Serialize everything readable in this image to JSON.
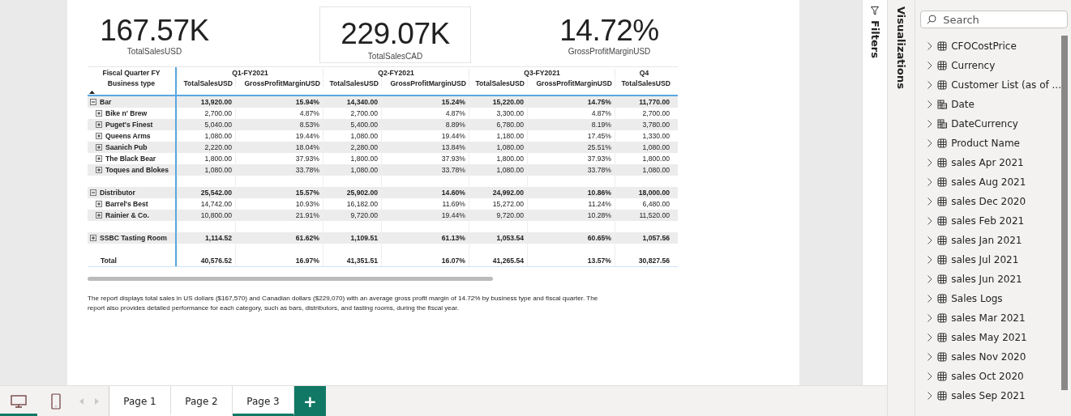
{
  "kpis": [
    {
      "value": "167.57K",
      "label": "TotalSalesUSD",
      "selected": false
    },
    {
      "value": "229.07K",
      "label": "TotalSalesCAD",
      "selected": true
    },
    {
      "value": "14.72%",
      "label": "GrossProfitMarginUSD",
      "selected": false
    }
  ],
  "matrix": {
    "corner_top": "Fiscal Quarter FY",
    "corner_bottom": "Business type",
    "column_groups": [
      {
        "label": "Q1-FY2021",
        "columns": [
          "TotalSalesUSD",
          "GrossProfitMarginUSD"
        ]
      },
      {
        "label": "Q2-FY2021",
        "columns": [
          "TotalSalesUSD",
          "GrossProfitMarginUSD"
        ]
      },
      {
        "label": "Q3-FY2021",
        "columns": [
          "TotalSalesUSD",
          "GrossProfitMarginUSD"
        ]
      },
      {
        "label": "Q4",
        "columns": [
          "TotalSalesUSD"
        ]
      }
    ],
    "rows": [
      {
        "kind": "group",
        "label": "Bar",
        "expanded": true,
        "cells": [
          "13,920.00",
          "15.94%",
          "14,340.00",
          "15.24%",
          "15,220.00",
          "14.75%",
          "11,770.00"
        ]
      },
      {
        "kind": "item",
        "label": "Bike n' Brew",
        "expanded": false,
        "cells": [
          "2,700.00",
          "4.87%",
          "2,700.00",
          "4.87%",
          "3,300.00",
          "4.87%",
          "2,700.00"
        ]
      },
      {
        "kind": "item",
        "label": "Puget's Finest",
        "expanded": false,
        "cells": [
          "5,040.00",
          "8.53%",
          "5,400.00",
          "8.89%",
          "6,780.00",
          "8.19%",
          "3,780.00"
        ]
      },
      {
        "kind": "item",
        "label": "Queens Arms",
        "expanded": false,
        "cells": [
          "1,080.00",
          "19.44%",
          "1,080.00",
          "19.44%",
          "1,180.00",
          "17.45%",
          "1,330.00"
        ]
      },
      {
        "kind": "item",
        "label": "Saanich Pub",
        "expanded": false,
        "cells": [
          "2,220.00",
          "18.04%",
          "2,280.00",
          "13.84%",
          "1,080.00",
          "25.51%",
          "1,080.00"
        ]
      },
      {
        "kind": "item",
        "label": "The Black Bear",
        "expanded": false,
        "cells": [
          "1,800.00",
          "37.93%",
          "1,800.00",
          "37.93%",
          "1,800.00",
          "37.93%",
          "1,800.00"
        ]
      },
      {
        "kind": "item",
        "label": "Toques and Blokes",
        "expanded": false,
        "cells": [
          "1,080.00",
          "33.78%",
          "1,080.00",
          "33.78%",
          "1,080.00",
          "33.78%",
          "1,080.00"
        ]
      },
      {
        "kind": "blank"
      },
      {
        "kind": "group",
        "label": "Distributor",
        "expanded": true,
        "cells": [
          "25,542.00",
          "15.57%",
          "25,902.00",
          "14.60%",
          "24,992.00",
          "10.86%",
          "18,000.00"
        ]
      },
      {
        "kind": "item",
        "label": "Barrel's Best",
        "expanded": false,
        "cells": [
          "14,742.00",
          "10.93%",
          "16,182.00",
          "11.69%",
          "15,272.00",
          "11.24%",
          "6,480.00"
        ]
      },
      {
        "kind": "item",
        "label": "Rainier & Co.",
        "expanded": false,
        "cells": [
          "10,800.00",
          "21.91%",
          "9,720.00",
          "19.44%",
          "9,720.00",
          "10.28%",
          "11,520.00"
        ]
      },
      {
        "kind": "blank"
      },
      {
        "kind": "group",
        "label": "SSBC Tasting Room",
        "expanded": false,
        "cells": [
          "1,114.52",
          "61.62%",
          "1,109.51",
          "61.13%",
          "1,053.54",
          "60.65%",
          "1,057.56"
        ]
      },
      {
        "kind": "blank"
      },
      {
        "kind": "total",
        "label": "Total",
        "cells": [
          "40,576.52",
          "16.97%",
          "41,351.51",
          "16.07%",
          "41,265.54",
          "13.57%",
          "30,827.56"
        ]
      }
    ]
  },
  "description": "The report displays total sales in US dollars ($167,570) and Canadian dollars ($229,070) with an average gross profit margin of 14.72% by business type and fiscal quarter. The report also provides detailed performance for each category, such as bars, distributors, and tasting rooms, during the fiscal year.",
  "filters_pane": {
    "title": "Filters"
  },
  "visualizations_pane": {
    "title": "Visualizations"
  },
  "data_pane": {
    "search": {
      "placeholder": "Search"
    },
    "tables": [
      {
        "name": "CFOCostPrice",
        "kind": "table"
      },
      {
        "name": "Currency",
        "kind": "table"
      },
      {
        "name": "Customer List (as of ...",
        "kind": "table"
      },
      {
        "name": "Date",
        "kind": "date"
      },
      {
        "name": "DateCurrency",
        "kind": "date"
      },
      {
        "name": "Product Name",
        "kind": "table"
      },
      {
        "name": "sales Apr 2021",
        "kind": "table"
      },
      {
        "name": "sales Aug 2021",
        "kind": "table"
      },
      {
        "name": "sales Dec 2020",
        "kind": "table"
      },
      {
        "name": "sales Feb 2021",
        "kind": "table"
      },
      {
        "name": "sales Jan 2021",
        "kind": "table"
      },
      {
        "name": "sales Jul 2021",
        "kind": "table"
      },
      {
        "name": "sales Jun 2021",
        "kind": "table"
      },
      {
        "name": "Sales Logs",
        "kind": "table"
      },
      {
        "name": "sales Mar 2021",
        "kind": "table"
      },
      {
        "name": "sales May 2021",
        "kind": "table"
      },
      {
        "name": "sales Nov 2020",
        "kind": "table"
      },
      {
        "name": "sales Oct 2020",
        "kind": "table"
      },
      {
        "name": "sales Sep 2021",
        "kind": "table"
      }
    ]
  },
  "view_modes": [
    {
      "kind": "desktop",
      "selected": true
    },
    {
      "kind": "mobile",
      "selected": false
    }
  ],
  "pages": [
    {
      "label": "Page 1",
      "selected": false
    },
    {
      "label": "Page 2",
      "selected": false
    },
    {
      "label": "Page 3",
      "selected": true
    }
  ],
  "add_page": {
    "label": "+"
  }
}
